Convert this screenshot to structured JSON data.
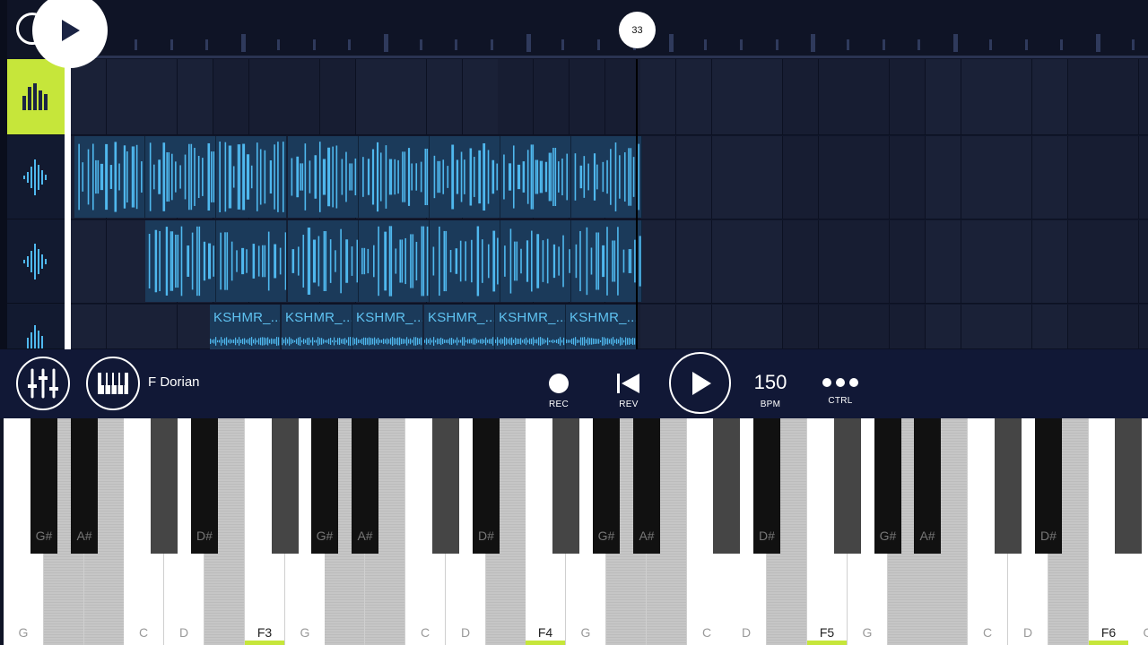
{
  "timeline": {
    "position_marker": "33"
  },
  "tracks": [
    {
      "name": "pattern-track",
      "icon": "bars-icon"
    },
    {
      "name": "audio-track-1",
      "icon": "waveform-icon"
    },
    {
      "name": "audio-track-2",
      "icon": "waveform-icon"
    },
    {
      "name": "audio-track-3",
      "icon": "waveform-icon"
    }
  ],
  "clips": {
    "track3_label": "KSHMR_..."
  },
  "toolbar": {
    "scale": "F Dorian",
    "rec_label": "REC",
    "rev_label": "REV",
    "bpm_value": "150",
    "bpm_label": "BPM",
    "ctrl_label": "CTRL"
  },
  "colors": {
    "accent": "#c6e63a",
    "clip": "#1b3a5a",
    "wave": "#4fb8ee",
    "background": "#0f1426"
  },
  "keyboard": {
    "white_keys": [
      {
        "note": "G",
        "in_scale": true
      },
      {
        "note": "A",
        "label": "",
        "in_scale": false
      },
      {
        "note": "B",
        "label": "",
        "in_scale": false
      },
      {
        "note": "C",
        "in_scale": true
      },
      {
        "note": "D",
        "in_scale": true
      },
      {
        "note": "E",
        "label": "",
        "in_scale": false
      },
      {
        "note": "F3",
        "in_scale": true,
        "root": true
      },
      {
        "note": "G",
        "in_scale": true
      },
      {
        "note": "A",
        "label": "",
        "in_scale": false
      },
      {
        "note": "B",
        "label": "",
        "in_scale": false
      },
      {
        "note": "C",
        "in_scale": true
      },
      {
        "note": "D",
        "in_scale": true
      },
      {
        "note": "E",
        "label": "",
        "in_scale": false
      },
      {
        "note": "F4",
        "in_scale": true,
        "root": true
      },
      {
        "note": "G",
        "in_scale": true
      },
      {
        "note": "A",
        "label": "",
        "in_scale": false
      },
      {
        "note": "B",
        "label": "",
        "in_scale": false
      },
      {
        "note": "C",
        "in_scale": true
      },
      {
        "note": "D",
        "in_scale": true
      },
      {
        "note": "E",
        "label": "",
        "in_scale": false
      },
      {
        "note": "F5",
        "in_scale": true,
        "root": true
      },
      {
        "note": "G",
        "in_scale": true
      },
      {
        "note": "A",
        "label": "",
        "in_scale": false
      },
      {
        "note": "B",
        "label": "",
        "in_scale": false
      },
      {
        "note": "C",
        "in_scale": true
      },
      {
        "note": "D",
        "in_scale": true
      },
      {
        "note": "E",
        "label": "",
        "in_scale": false
      },
      {
        "note": "F6",
        "in_scale": true,
        "root": true
      },
      {
        "note": "G",
        "in_scale": true
      }
    ],
    "black_keys": [
      {
        "label": "G#",
        "in_scale": true
      },
      {
        "label": "A#",
        "in_scale": true
      },
      {
        "label": "",
        "in_scale": false
      },
      {
        "label": "D#",
        "in_scale": true
      },
      {
        "label": "",
        "in_scale": false
      },
      {
        "label": "G#",
        "in_scale": true
      },
      {
        "label": "A#",
        "in_scale": true
      },
      {
        "label": "",
        "in_scale": false
      },
      {
        "label": "D#",
        "in_scale": true
      },
      {
        "label": "",
        "in_scale": false
      },
      {
        "label": "G#",
        "in_scale": true
      },
      {
        "label": "A#",
        "in_scale": true
      },
      {
        "label": "",
        "in_scale": false
      },
      {
        "label": "D#",
        "in_scale": true
      },
      {
        "label": "",
        "in_scale": false
      },
      {
        "label": "G#",
        "in_scale": true
      },
      {
        "label": "A#",
        "in_scale": true
      },
      {
        "label": "",
        "in_scale": false
      },
      {
        "label": "D#",
        "in_scale": true
      },
      {
        "label": "",
        "in_scale": false
      }
    ]
  }
}
